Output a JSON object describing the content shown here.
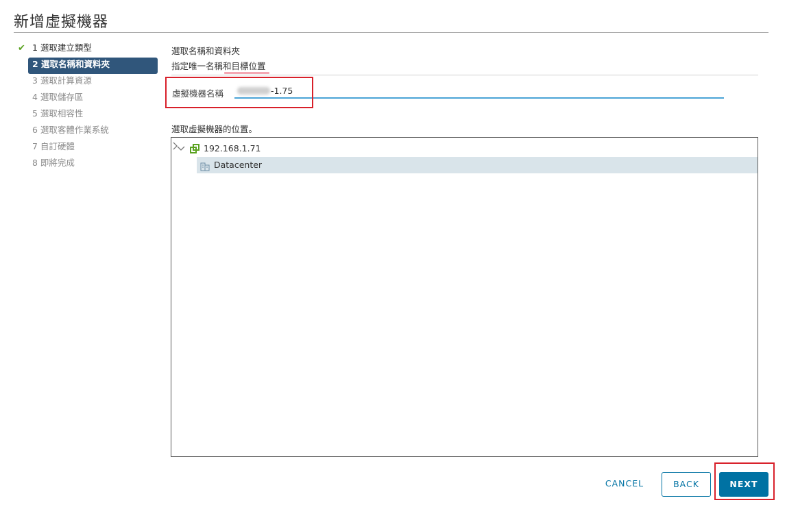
{
  "header": {
    "title": "新增虛擬機器"
  },
  "steps": [
    {
      "label": "1 選取建立類型",
      "state": "done"
    },
    {
      "label": "2 選取名稱和資料夾",
      "state": "active"
    },
    {
      "label": "3 選取計算資源",
      "state": "pending"
    },
    {
      "label": "4 選取儲存區",
      "state": "pending"
    },
    {
      "label": "5 選取相容性",
      "state": "pending"
    },
    {
      "label": "6 選取客體作業系統",
      "state": "pending"
    },
    {
      "label": "7 自訂硬體",
      "state": "pending"
    },
    {
      "label": "8 即將完成",
      "state": "pending"
    }
  ],
  "section": {
    "title": "選取名稱和資料夾",
    "subtitle": "指定唯一名稱和目標位置"
  },
  "vm_name": {
    "label": "虛擬機器名稱",
    "value_visible_suffix": "-1.75"
  },
  "location": {
    "label": "選取虛擬機器的位置。",
    "tree": [
      {
        "label": "192.168.1.71",
        "icon": "vcenter-host-icon",
        "expanded": true
      },
      {
        "label": "Datacenter",
        "icon": "datacenter-icon",
        "expanded": false,
        "selected": true
      }
    ]
  },
  "footer": {
    "cancel_label": "CANCEL",
    "back_label": "BACK",
    "next_label": "NEXT"
  },
  "colors": {
    "accent": "#0072a3",
    "active_step": "#30567b",
    "done_check": "#5aa220",
    "highlight_box": "#d8202a",
    "selected_row": "#d9e4ea"
  }
}
